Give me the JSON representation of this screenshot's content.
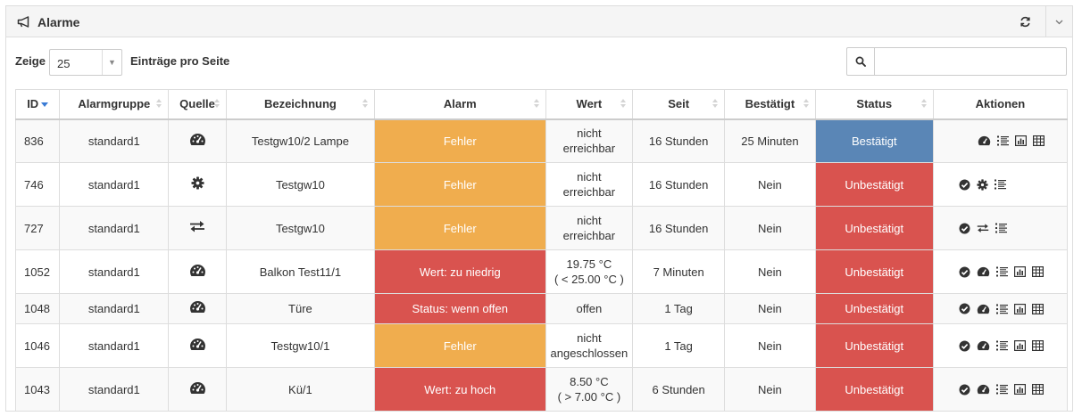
{
  "panel": {
    "title": "Alarme",
    "title_icon": "bullhorn-icon"
  },
  "toolbar": {
    "show_label": "Zeige",
    "page_size": "25",
    "per_page_label": "Einträge pro Seite",
    "search_value": "",
    "search_placeholder": ""
  },
  "table": {
    "headers": [
      "ID",
      "Alarmgruppe",
      "Quelle",
      "Bezeichnung",
      "Alarm",
      "Wert",
      "Seit",
      "Bestätigt",
      "Status",
      "Aktionen"
    ],
    "rows": [
      {
        "id": "836",
        "group": "standard1",
        "source_icon": "dashboard-icon",
        "name": "Testgw10/2 Lampe",
        "alarm": "Fehler",
        "alarm_level": "warning",
        "value_1": "nicht",
        "value_2": "erreichbar",
        "since": "16 Stunden",
        "confirmed": "25 Minuten",
        "status": "Bestätigt",
        "status_level": "confirmed",
        "actions": [
          "dashboard",
          "list",
          "chart",
          "table"
        ]
      },
      {
        "id": "746",
        "group": "standard1",
        "source_icon": "gear-icon",
        "name": "Testgw10",
        "alarm": "Fehler",
        "alarm_level": "warning",
        "value_1": "nicht",
        "value_2": "erreichbar",
        "since": "16 Stunden",
        "confirmed": "Nein",
        "status": "Unbestätigt",
        "status_level": "unconfirmed",
        "actions": [
          "confirm",
          "gear",
          "list"
        ]
      },
      {
        "id": "727",
        "group": "standard1",
        "source_icon": "exchange-icon",
        "name": "Testgw10",
        "alarm": "Fehler",
        "alarm_level": "warning",
        "value_1": "nicht",
        "value_2": "erreichbar",
        "since": "16 Stunden",
        "confirmed": "Nein",
        "status": "Unbestätigt",
        "status_level": "unconfirmed",
        "actions": [
          "confirm",
          "exchange",
          "list"
        ]
      },
      {
        "id": "1052",
        "group": "standard1",
        "source_icon": "dashboard-icon",
        "name": "Balkon Test11/1",
        "alarm": "Wert: zu niedrig",
        "alarm_level": "danger",
        "value_1": "19.75 °C",
        "value_2": "( < 25.00 °C )",
        "since": "7 Minuten",
        "confirmed": "Nein",
        "status": "Unbestätigt",
        "status_level": "unconfirmed",
        "actions": [
          "confirm",
          "dashboard",
          "list",
          "chart",
          "table"
        ]
      },
      {
        "id": "1048",
        "group": "standard1",
        "source_icon": "dashboard-icon",
        "name": "Türe",
        "alarm": "Status: wenn offen",
        "alarm_level": "danger",
        "value_1": "offen",
        "value_2": "",
        "since": "1 Tag",
        "confirmed": "Nein",
        "status": "Unbestätigt",
        "status_level": "unconfirmed",
        "actions": [
          "confirm",
          "dashboard",
          "list",
          "chart",
          "table"
        ]
      },
      {
        "id": "1046",
        "group": "standard1",
        "source_icon": "dashboard-icon",
        "name": "Testgw10/1",
        "alarm": "Fehler",
        "alarm_level": "warning",
        "value_1": "nicht",
        "value_2": "angeschlossen",
        "since": "1 Tag",
        "confirmed": "Nein",
        "status": "Unbestätigt",
        "status_level": "unconfirmed",
        "actions": [
          "confirm",
          "dashboard",
          "list",
          "chart",
          "table"
        ]
      },
      {
        "id": "1043",
        "group": "standard1",
        "source_icon": "dashboard-icon",
        "name": "Kü/1",
        "alarm": "Wert: zu hoch",
        "alarm_level": "danger",
        "value_1": "8.50 °C",
        "value_2": "( > 7.00 °C )",
        "since": "6 Stunden",
        "confirmed": "Nein",
        "status": "Unbestätigt",
        "status_level": "unconfirmed",
        "actions": [
          "confirm",
          "dashboard",
          "list",
          "chart",
          "table"
        ]
      }
    ]
  },
  "colors": {
    "warning": "#f0ad4e",
    "danger": "#d9534f",
    "confirmed": "#5a86b6",
    "sort_active": "#3a7bd5"
  }
}
